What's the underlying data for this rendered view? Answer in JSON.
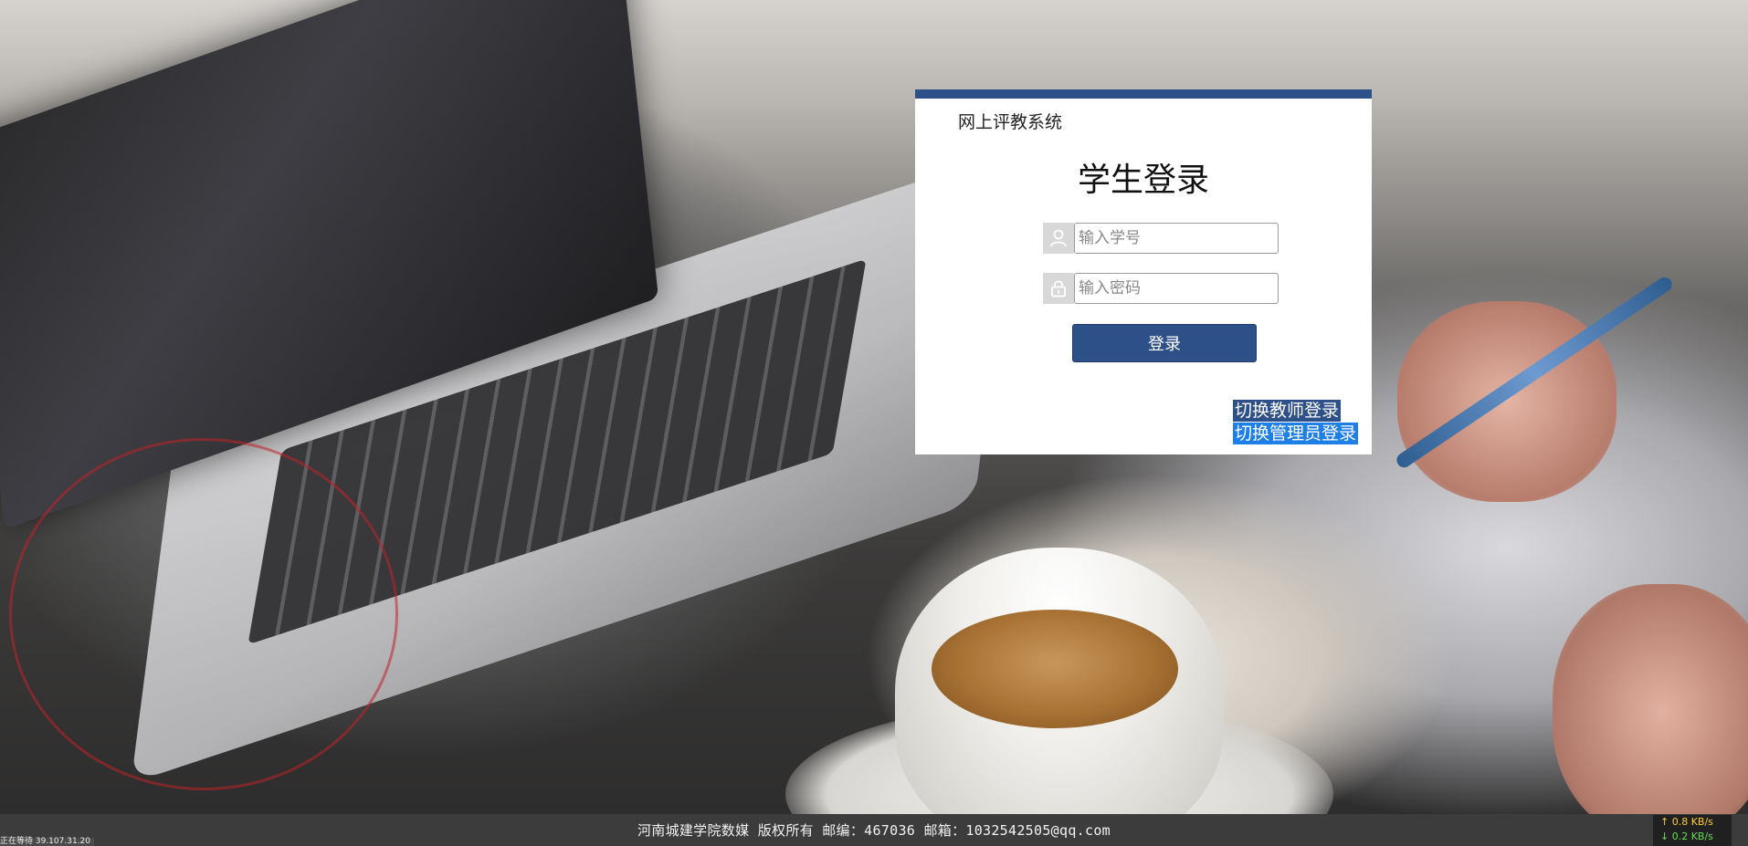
{
  "app": {
    "system_title": "网上评教系统",
    "login_title": "学生登录"
  },
  "form": {
    "username_placeholder": "输入学号",
    "password_placeholder": "输入密码",
    "login_button": "登录"
  },
  "switch_links": {
    "teacher": "切换教师登录",
    "admin": "切换管理员登录"
  },
  "footer": {
    "text": "河南城建学院数媒 版权所有  邮编：467036  邮箱：1032542505@qq.com"
  },
  "browser_status": {
    "text": "正在等待 39.107.31.20"
  },
  "net_monitor": {
    "upload": "↑ 0.8 KB/s",
    "download": "↓ 0.2 KB/s"
  },
  "colors": {
    "brand_blue": "#2d5089",
    "admin_highlight": "#1e7fe6"
  },
  "icons": {
    "username": "user-icon",
    "password": "lock-icon"
  }
}
